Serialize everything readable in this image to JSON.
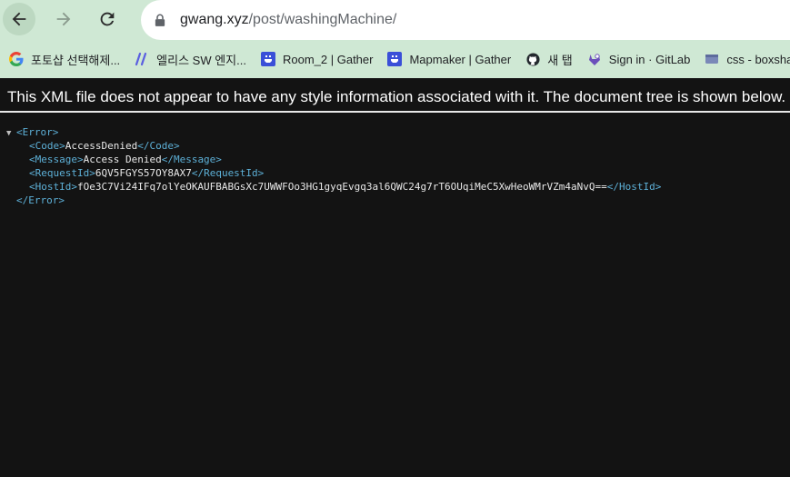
{
  "browser": {
    "url_host": "gwang.xyz",
    "url_path": "/post/washingMachine/",
    "nav": {
      "back_icon": "arrow-left-icon",
      "forward_icon": "arrow-right-icon",
      "reload_icon": "reload-icon"
    }
  },
  "bookmarks": [
    {
      "label": "포토샵 선택해제...",
      "icon": "google-g-icon"
    },
    {
      "label": "엘리스 SW 엔지...",
      "icon": "slashes-icon"
    },
    {
      "label": "Room_2 | Gather",
      "icon": "gather-icon"
    },
    {
      "label": "Mapmaker | Gather",
      "icon": "gather-icon"
    },
    {
      "label": "새 탭",
      "icon": "github-icon"
    },
    {
      "label": "Sign in · GitLab",
      "icon": "gitlab-icon"
    },
    {
      "label": "css - boxshado",
      "icon": "folder-icon"
    }
  ],
  "xml_viewer": {
    "notice": "This XML file does not appear to have any style information associated with it. The document tree is shown below.",
    "toggle": "▼",
    "root_open": "<Error>",
    "root_close": "</Error>",
    "children": [
      {
        "open": "<Code>",
        "value": "AccessDenied",
        "close": "</Code>"
      },
      {
        "open": "<Message>",
        "value": "Access Denied",
        "close": "</Message>"
      },
      {
        "open": "<RequestId>",
        "value": "6QV5FGYS57OY8AX7",
        "close": "</RequestId>"
      },
      {
        "open": "<HostId>",
        "value": "fOe3C7Vi24IFq7olYeOKAUFBABGsXc7UWWFOo3HG1gyqEvgq3al6QWC24g7rT6OUqiMeC5XwHeoWMrVZm4aNvQ==",
        "close": "</HostId>"
      }
    ]
  },
  "colors": {
    "toolbar_bg": "#cfe8d4",
    "page_bg": "#131313",
    "tag": "#5db0d7"
  }
}
